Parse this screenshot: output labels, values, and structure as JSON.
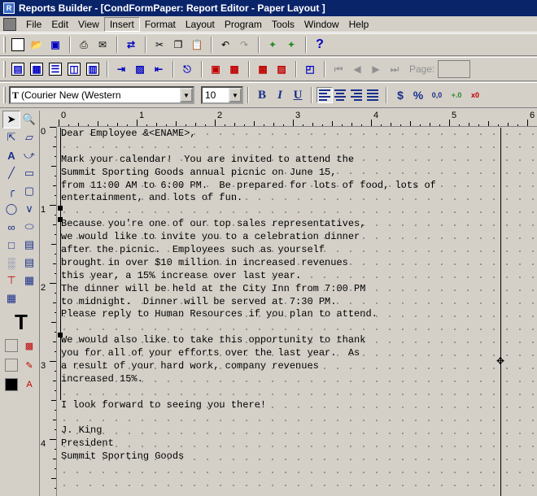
{
  "window": {
    "title": "Reports Builder - [CondFormPaper: Report Editor - Paper Layout ]"
  },
  "menu": [
    "File",
    "Edit",
    "View",
    "Insert",
    "Format",
    "Layout",
    "Program",
    "Tools",
    "Window",
    "Help"
  ],
  "menu_active": "Insert",
  "toolbar2": {
    "page_label": "Page:",
    "page_value": ""
  },
  "format_bar": {
    "font_value": "(Courier New (Western",
    "size_value": "10",
    "bold": "B",
    "italic": "I",
    "underline": "U",
    "currency": "$",
    "percent": "%",
    "commas": "0,0",
    "add_decimal": "+.0",
    "remove_decimal": "x0"
  },
  "ruler": {
    "horizontal": [
      "0",
      "1",
      "2",
      "3",
      "4",
      "5",
      "6"
    ],
    "vertical": [
      "0",
      "1",
      "2",
      "3",
      "4"
    ]
  },
  "report": {
    "lines": [
      "Dear Employee &<ENAME>,",
      "",
      "Mark your calendar!  You are invited to attend the",
      "Summit Sporting Goods annual picnic on June 15,",
      "from 11:00 AM to 6:00 PM.  Be prepared for lots of food, lots of",
      "entertainment, and lots of fun.",
      "",
      "Because you're one of our top sales representatives,",
      "we would like to invite you to a celebration dinner",
      "after the picnic.  Employees such as yourself",
      "brought in over $10 million in increased revenues",
      "this year, a 15% increase over last year.",
      "The dinner will be held at the City Inn from 7:00 PM",
      "to midnight.  Dinner will be served at 7:30 PM.",
      "Please reply to Human Resources if you plan to attend.",
      "",
      "We would also like to take this opportunity to thank",
      "you for all of your efforts over the last year.  As",
      "a result of your hard work, company revenues",
      "increased 15%.",
      "",
      "I look forward to seeing you there!",
      "",
      "J. King",
      "President",
      "Summit Sporting Goods"
    ]
  },
  "colors": {
    "title_bar": "#0a246a",
    "toolbar_bg": "#d4d0c8",
    "icon_blue": "#1a2f8a"
  }
}
